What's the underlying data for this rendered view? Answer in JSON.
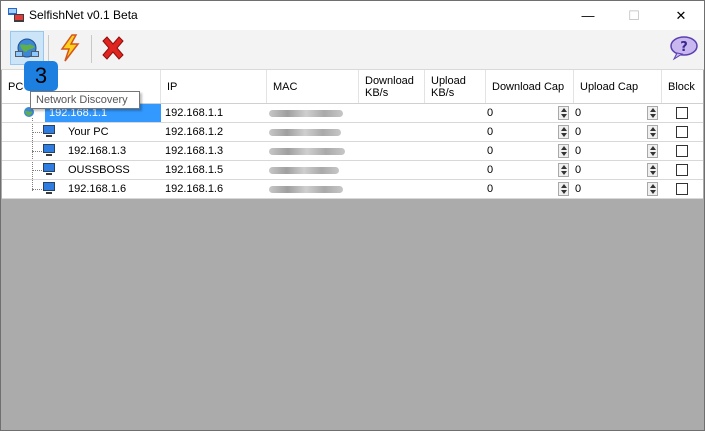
{
  "window": {
    "title": "SelfishNet v0.1 Beta"
  },
  "titlebar_buttons": {
    "minimize": "—",
    "maximize": "☐",
    "close": "✕"
  },
  "toolbar": {
    "discover_icon": "globe-network-icon",
    "flash_icon": "lightning-icon",
    "stop_icon": "red-x-icon",
    "help_icon": "help-bubble-icon"
  },
  "step_badge": "3",
  "tooltip": "Network Discovery",
  "columns": {
    "pc": "PC",
    "ip": "IP",
    "mac": "MAC",
    "download": "Download KB/s",
    "upload": "Upload KB/s",
    "download_cap": "Download Cap",
    "upload_cap": "Upload Cap",
    "block": "Block"
  },
  "rows": [
    {
      "name": "192.168.1.1",
      "ip": "192.168.1.1",
      "download": "",
      "upload": "",
      "download_cap": "0",
      "upload_cap": "0",
      "block": false
    },
    {
      "name": "Your PC",
      "ip": "192.168.1.2",
      "download": "",
      "upload": "",
      "download_cap": "0",
      "upload_cap": "0",
      "block": false
    },
    {
      "name": "192.168.1.3",
      "ip": "192.168.1.3",
      "download": "",
      "upload": "",
      "download_cap": "0",
      "upload_cap": "0",
      "block": false
    },
    {
      "name": "OUSSBOSS",
      "ip": "192.168.1.5",
      "download": "",
      "upload": "",
      "download_cap": "0",
      "upload_cap": "0",
      "block": false
    },
    {
      "name": "192.168.1.6",
      "ip": "192.168.1.6",
      "download": "",
      "upload": "",
      "download_cap": "0",
      "upload_cap": "0",
      "block": false
    }
  ],
  "colors": {
    "selection": "#3399ff",
    "badge": "#1d7fdf",
    "empty_area": "#ababab"
  }
}
